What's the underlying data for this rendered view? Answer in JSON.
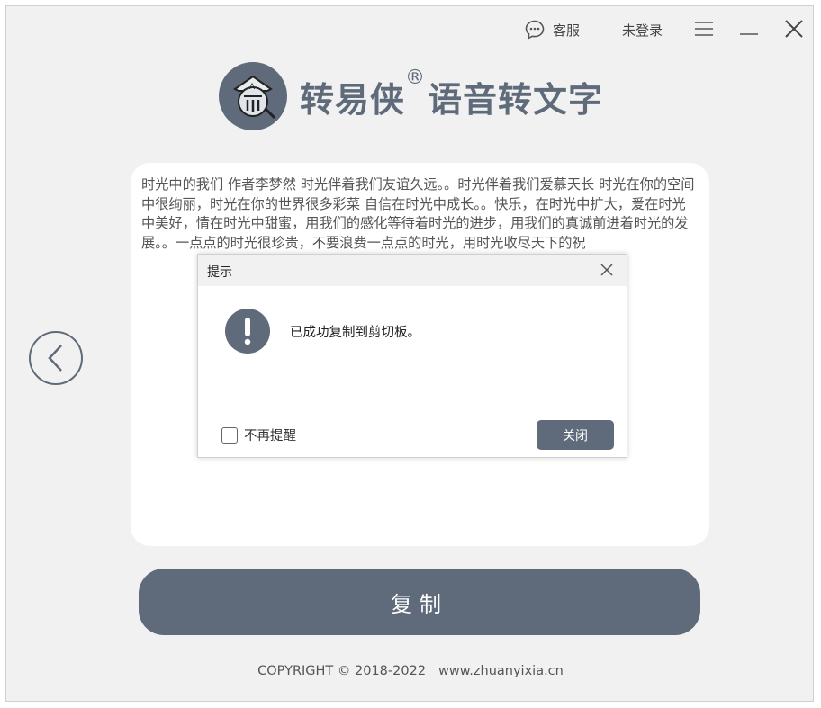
{
  "titlebar": {
    "customer_service_label": "客服",
    "login_label": "未登录"
  },
  "app": {
    "title": "转易侠",
    "registered_mark": "®",
    "subtitle": "语音转文字"
  },
  "content": {
    "text": "时光中的我们  作者李梦然  时光伴着我们友谊久远。。时光伴着我们爱慕天长  时光在你的空间中很绚丽，时光在你的世界很多彩菜  自信在时光中成长。。快乐，在时光中扩大，爱在时光中美好，情在时光中甜蜜，用我们的感化等待着时光的进步，用我们的真诚前进着时光的发展。。一点点的时光很珍贵，不要浪费一点点的时光，用时光收尽天下的祝"
  },
  "copy_button_label": "复制",
  "footer": {
    "copyright": "COPYRIGHT © 2018-2022",
    "website": "www.zhuanyixia.cn"
  },
  "dialog": {
    "title": "提示",
    "message": "已成功复制到剪切板。",
    "checkbox_label": "不再提醒",
    "checkbox_checked": false,
    "close_button_label": "关闭"
  },
  "colors": {
    "accent": "#5f6b7a",
    "window_bg": "#f1f1f1",
    "card_bg": "#ffffff"
  },
  "icons": [
    "chat-bubble-icon",
    "hamburger-menu-icon",
    "minimize-icon",
    "close-icon",
    "knight-logo-icon",
    "chevron-left-icon",
    "exclamation-icon"
  ]
}
